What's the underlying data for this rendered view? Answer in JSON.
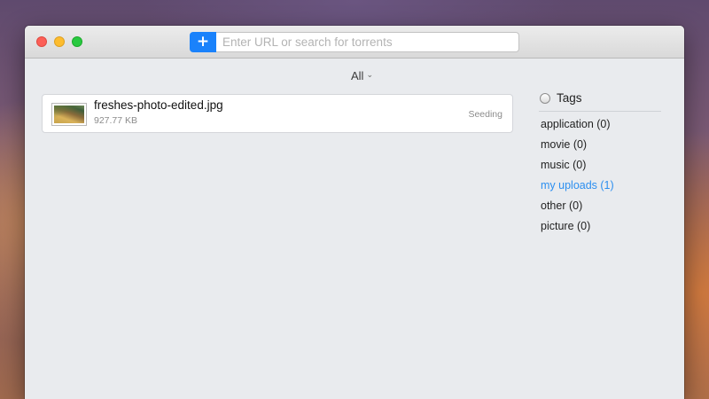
{
  "toolbar": {
    "add_label": "+",
    "search_placeholder": "Enter URL or search for torrents"
  },
  "filter": {
    "selected": "All",
    "chevron": "⌄"
  },
  "torrents": [
    {
      "name": "freshes-photo-edited.jpg",
      "size": "927.77 KB",
      "status": "Seeding",
      "thumbnail_icon": "image-thumbnail"
    }
  ],
  "tags": {
    "header": "Tags",
    "items": [
      {
        "label": "application (0)",
        "active": false
      },
      {
        "label": "movie (0)",
        "active": false
      },
      {
        "label": "music (0)",
        "active": false
      },
      {
        "label": "my uploads (1)",
        "active": true
      },
      {
        "label": "other (0)",
        "active": false
      },
      {
        "label": "picture (0)",
        "active": false
      }
    ]
  },
  "colors": {
    "accent": "#1a82fb",
    "active_tag": "#2c8ff0"
  }
}
